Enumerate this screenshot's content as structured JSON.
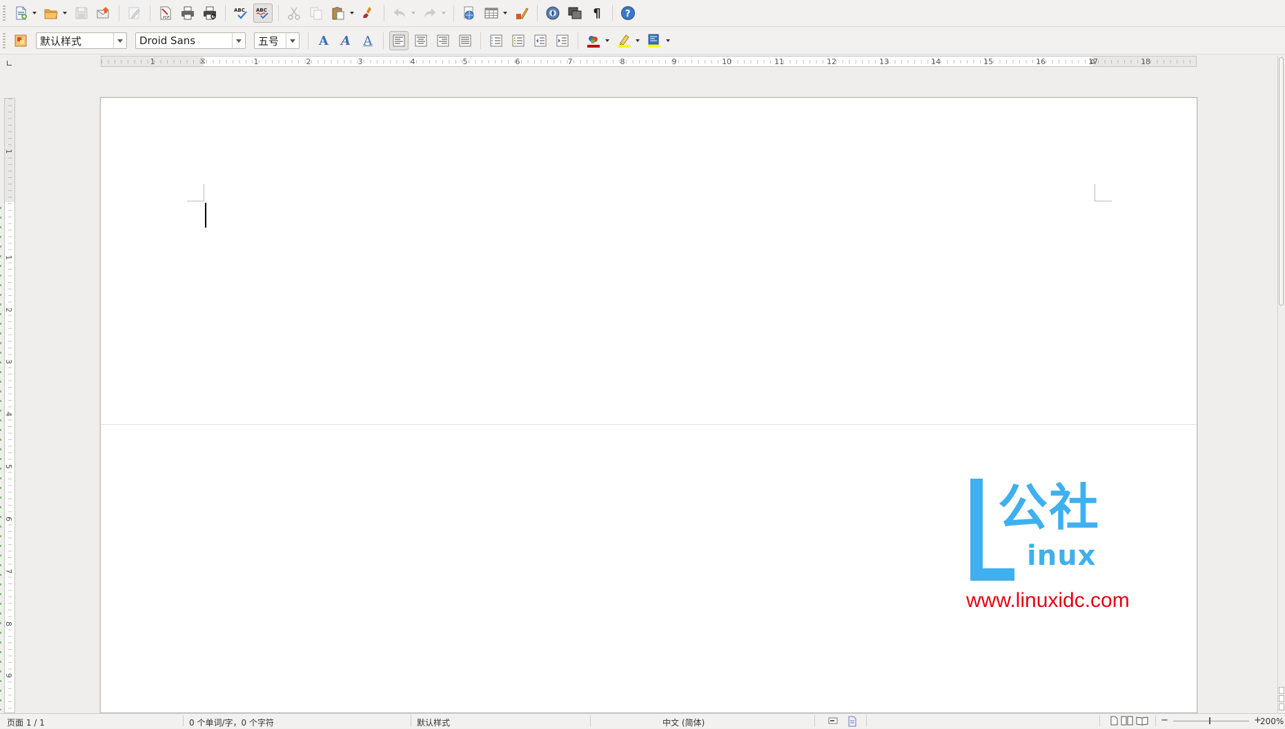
{
  "toolbar1": {
    "buttons": [
      {
        "name": "new-document",
        "icon": "new-document-icon",
        "dropdown": true
      },
      {
        "name": "open",
        "icon": "folder-open-icon",
        "dropdown": true
      },
      {
        "name": "save",
        "icon": "save-icon",
        "disabled": true
      },
      {
        "name": "send-email",
        "icon": "email-icon"
      },
      {
        "name": "edit-file",
        "icon": "pencil-icon",
        "disabled": true
      },
      {
        "name": "export-pdf",
        "icon": "pdf-icon"
      },
      {
        "name": "print",
        "icon": "printer-icon"
      },
      {
        "name": "print-preview",
        "icon": "print-preview-icon"
      },
      {
        "name": "spellcheck",
        "icon": "spellcheck-icon"
      },
      {
        "name": "autocheck-spelling",
        "icon": "autospell-icon",
        "active": true
      },
      {
        "name": "cut",
        "icon": "scissors-icon",
        "disabled": true
      },
      {
        "name": "copy",
        "icon": "copy-icon",
        "disabled": true
      },
      {
        "name": "paste",
        "icon": "clipboard-icon",
        "dropdown": true
      },
      {
        "name": "clone-formatting",
        "icon": "paintbrush-icon"
      },
      {
        "name": "undo",
        "icon": "undo-icon",
        "disabled": true,
        "dropdown": true
      },
      {
        "name": "redo",
        "icon": "redo-icon",
        "disabled": true,
        "dropdown": true
      },
      {
        "name": "hyperlink",
        "icon": "globe-link-icon"
      },
      {
        "name": "table",
        "icon": "table-icon",
        "dropdown": true
      },
      {
        "name": "show-draw-functions",
        "icon": "draw-functions-icon"
      },
      {
        "name": "navigator",
        "icon": "navigator-icon"
      },
      {
        "name": "gallery",
        "icon": "gallery-icon"
      },
      {
        "name": "formatting-marks",
        "icon": "pilcrow-icon",
        "glyph": "¶"
      },
      {
        "name": "help",
        "icon": "help-icon",
        "glyph": "?"
      }
    ]
  },
  "toolbar2": {
    "paragraph_style": "默认样式",
    "font_name": "Droid Sans",
    "font_size": "五号",
    "bold_glyph": "A",
    "italic_glyph": "A",
    "underline_glyph": "A"
  },
  "rulers": {
    "horizontal_numbers": [
      "1",
      "1",
      "2",
      "3",
      "4",
      "5",
      "6",
      "7",
      "8",
      "9",
      "10",
      "11",
      "12",
      "13",
      "14",
      "15",
      "16",
      "17",
      "18"
    ],
    "vertical_numbers": [
      "1",
      "1",
      "2",
      "3",
      "4",
      "5",
      "6",
      "7",
      "8",
      "9"
    ]
  },
  "watermark": {
    "letter_l": "L",
    "chinese": "公社",
    "english": "inux",
    "url": "www.linuxidc.com"
  },
  "statusbar": {
    "page": "页面 1 / 1",
    "word_count": "0 个单词/字，0 个字符",
    "page_style": "默认样式",
    "language": "中文 (简体)",
    "zoom_minus": "−",
    "zoom_plus": "+",
    "zoom": "200%"
  },
  "colors": {
    "watermark_blue": "#3fb0ef",
    "watermark_red": "#e60012",
    "font_color": "#c00000",
    "highlight": "#ffff00"
  }
}
